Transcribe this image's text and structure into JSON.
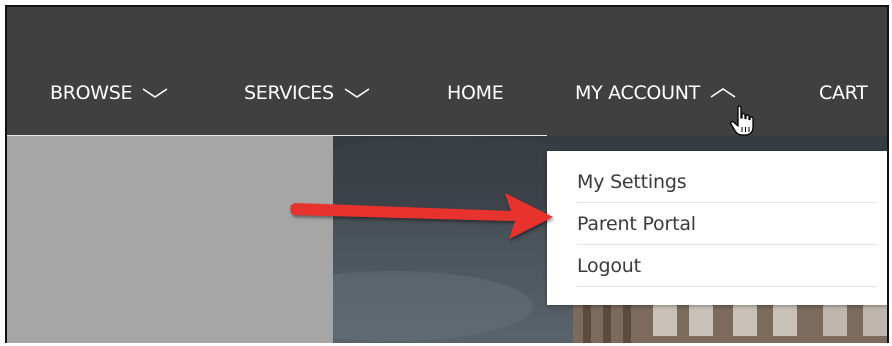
{
  "nav": {
    "items": [
      {
        "label": "BROWSE"
      },
      {
        "label": "SERVICES"
      },
      {
        "label": "HOME"
      },
      {
        "label": "MY ACCOUNT"
      },
      {
        "label": "CART"
      }
    ]
  },
  "account_menu": {
    "items": [
      {
        "label": "My Settings"
      },
      {
        "label": "Parent Portal"
      },
      {
        "label": "Logout"
      }
    ]
  },
  "colors": {
    "navbar_bg": "#404040",
    "annotation_arrow": "#e8312f"
  },
  "icons": {
    "browse_chevron": "chevron-down-icon",
    "services_chevron": "chevron-down-icon",
    "account_chevron": "chevron-up-icon",
    "cursor": "hand-pointer-icon",
    "annotation": "arrow-right-icon"
  }
}
